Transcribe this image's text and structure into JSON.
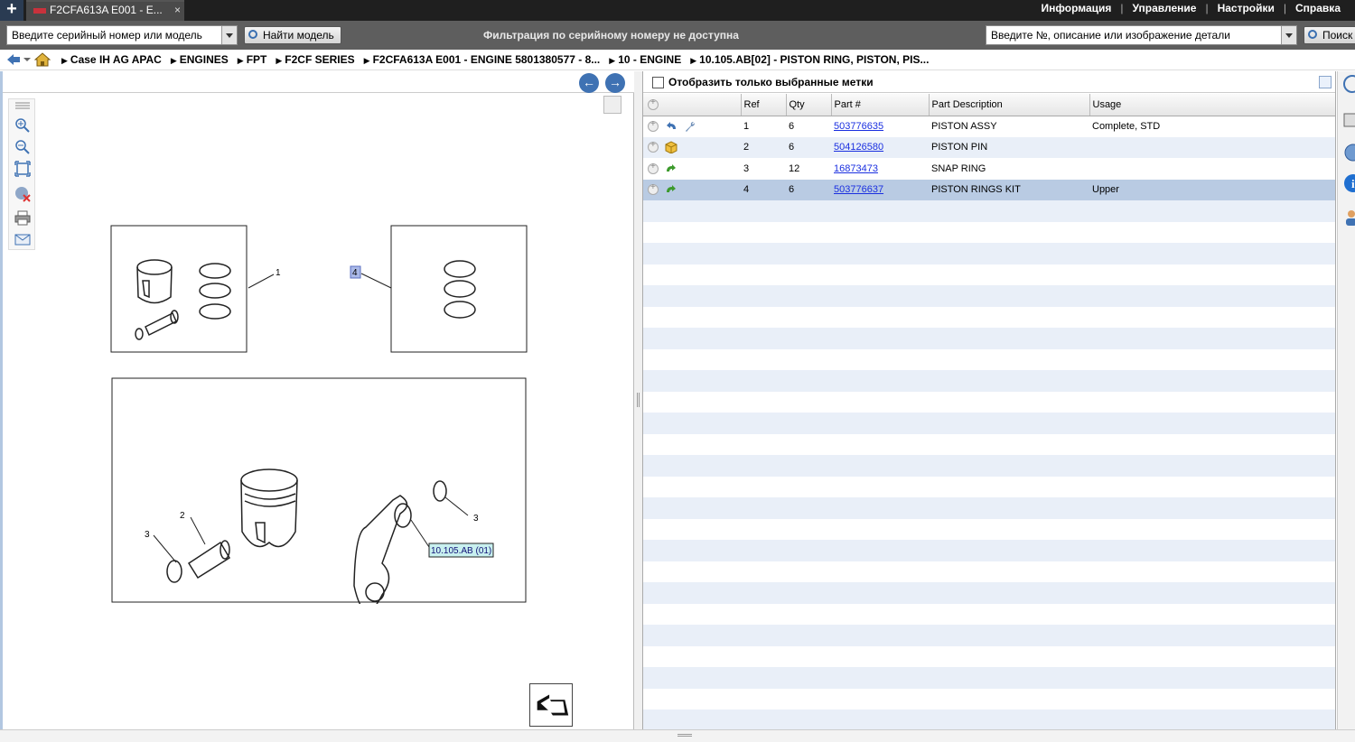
{
  "tabs": {
    "new_tab": "+",
    "active_tab": "F2CFA613A E001 - E...",
    "close": "×"
  },
  "top_menu": {
    "info": "Информация",
    "manage": "Управление",
    "settings": "Настройки",
    "help": "Справка"
  },
  "search": {
    "serial_placeholder": "Введите серийный номер или модель",
    "find_model_label": "Найти модель",
    "filter_message": "Фильтрация по серийному номеру не доступна",
    "part_placeholder": "Введите №, описание или изображение детали",
    "search_label": "Поиск"
  },
  "breadcrumb": [
    "Case IH AG APAC",
    "ENGINES",
    "FPT",
    "F2CF SERIES",
    "F2CFA613A E001 - ENGINE 5801380577 - 8...",
    "10 - ENGINE",
    "10.105.AB[02] - PISTON RING, PISTON, PIS..."
  ],
  "drawing": {
    "callout_1": "1",
    "callout_2": "2",
    "callout_3a": "3",
    "callout_3b": "3",
    "callout_4": "4",
    "ref_link": "10.105.AB (01)"
  },
  "parts_panel": {
    "show_selected_label": "Отобразить только выбранные метки",
    "columns": [
      "Ref",
      "Qty",
      "Part #",
      "Part Description",
      "Usage"
    ],
    "rows": [
      {
        "ref": "1",
        "qty": "6",
        "part": "503776635",
        "desc": "PISTON ASSY",
        "usage": "Complete, STD"
      },
      {
        "ref": "2",
        "qty": "6",
        "part": "504126580",
        "desc": "PISTON PIN",
        "usage": ""
      },
      {
        "ref": "3",
        "qty": "12",
        "part": "16873473",
        "desc": "SNAP RING",
        "usage": ""
      },
      {
        "ref": "4",
        "qty": "6",
        "part": "503776637",
        "desc": "PISTON RINGS KIT",
        "usage": "Upper"
      }
    ]
  },
  "colors": {
    "accent": "#3f72b3",
    "selected_row": "#b9cbe3",
    "alt_row": "#e9eff8",
    "link": "#1a2fe0"
  }
}
